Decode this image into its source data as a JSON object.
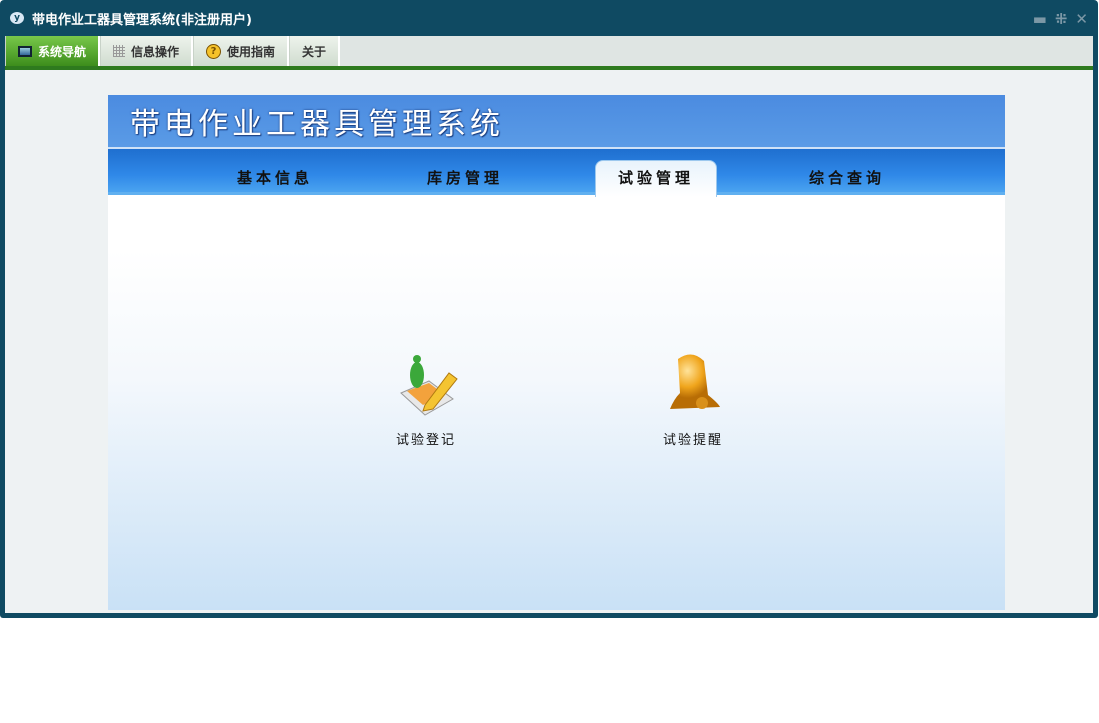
{
  "window": {
    "title": "带电作业工器具管理系统(非注册用户)",
    "logo": "yf",
    "controls": [
      "minimize-icon",
      "restore-icon",
      "close-icon"
    ]
  },
  "menu": [
    {
      "label": "系统导航",
      "icon": "monitor-icon"
    },
    {
      "label": "信息操作",
      "icon": "grid-icon"
    },
    {
      "label": "使用指南",
      "icon": "help-icon"
    },
    {
      "label": "关于",
      "icon": ""
    }
  ],
  "header": {
    "title": "带电作业工器具管理系统"
  },
  "nav": [
    {
      "label": "基本信息"
    },
    {
      "label": "库房管理"
    },
    {
      "label": "试验管理"
    },
    {
      "label": "综合查询"
    }
  ],
  "items": [
    {
      "label": "试验登记",
      "icon": "test-register-icon"
    },
    {
      "label": "试验提醒",
      "icon": "bell-icon"
    }
  ]
}
